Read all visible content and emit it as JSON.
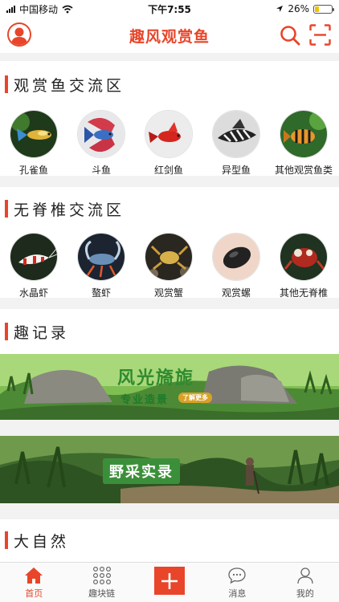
{
  "status_bar": {
    "carrier": "中国移动",
    "time": "下午7:55",
    "battery_percent": "26%",
    "battery_level": 0.26
  },
  "header": {
    "title": "趣风观赏鱼"
  },
  "sections": {
    "fish": {
      "title": "观赏鱼交流区",
      "items": [
        {
          "label": "孔雀鱼"
        },
        {
          "label": "斗鱼"
        },
        {
          "label": "红剑鱼"
        },
        {
          "label": "异型鱼"
        },
        {
          "label": "其他观赏鱼类"
        }
      ]
    },
    "invertebrates": {
      "title": "无脊椎交流区",
      "items": [
        {
          "label": "水晶虾"
        },
        {
          "label": "螯虾"
        },
        {
          "label": "观赏蟹"
        },
        {
          "label": "观赏螺"
        },
        {
          "label": "其他无脊椎"
        }
      ]
    },
    "records": {
      "title": "趣记录",
      "banners": [
        {
          "caption": "风光旖旎",
          "subcaption": "专业造景",
          "tag": "了解更多"
        },
        {
          "caption": "野采实录"
        }
      ]
    },
    "nature": {
      "title": "大自然"
    }
  },
  "tabbar": {
    "items": [
      {
        "label": "首页"
      },
      {
        "label": "趣块链"
      },
      {
        "label": ""
      },
      {
        "label": "消息"
      },
      {
        "label": "我的"
      }
    ]
  },
  "colors": {
    "accent": "#e8452a",
    "section_bg": "#f2f2f2"
  }
}
